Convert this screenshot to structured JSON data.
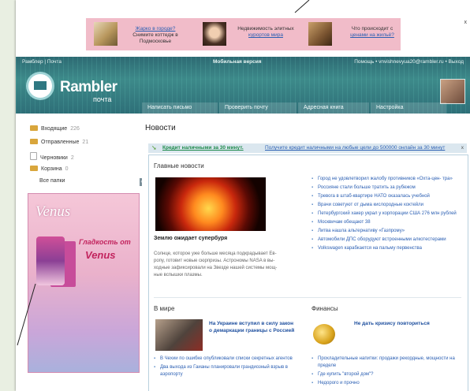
{
  "ads": [
    {
      "link": "Жарко в городе?",
      "text": "Снимите коттедж в Подмосковье"
    },
    {
      "text": "Недвижимость элитных",
      "link": "курортов мира"
    },
    {
      "text": "Что происходит с",
      "link": "ценами на жильё?"
    }
  ],
  "ad_close": "x",
  "header": {
    "left": "Рамблер | Почта",
    "center": "Мобильная версия",
    "right": "Помощь  •  vnvishnevyua20@rambler.ru  •  Выход",
    "logo": "Rambler",
    "logo_sub": "почта",
    "accent": "#2d6a73"
  },
  "tabs": [
    "Написать письмо",
    "Проверить почту",
    "Адресная книга",
    "Настройка"
  ],
  "folders": [
    {
      "label": "Входящие",
      "count": "226",
      "icon": "folder-icon"
    },
    {
      "label": "Отправленные",
      "count": "21",
      "icon": "folder-icon"
    },
    {
      "label": "Черновики",
      "count": "2",
      "icon": "draft-icon"
    },
    {
      "label": "Корзина",
      "count": "0",
      "icon": "trash-icon"
    }
  ],
  "all_folders": "Все папки",
  "venus": {
    "brand": "Venus",
    "slogan1": "Гладкость от",
    "slogan2": "Venus"
  },
  "main": {
    "title": "Новости",
    "credit": {
      "headline": "Кредит наличными за 30 минут.",
      "link": "Получите кредит наличными на любые цели до 500000 онлайн за 30 минут",
      "close": "x"
    },
    "main_news": "Главные новости",
    "lead": {
      "headline": "Землю ожидает супербуря",
      "text": "Солнце, которое уже больше месяца подкрадывает Ев- ропу, готовит новые сюрпризы. Астрономы NASA в вы- ходные зафиксировали на Звезде нашей системы мощ- ные вспышки плазмы."
    },
    "headlines": [
      "Город не удовлетворил жалобу противников «Охта-цен- тра»",
      "Россияне стали больше тратить за рубежом",
      "Тревога в штаб-квартире НАТО оказалась учебной",
      "Врачи советуют от дыма кислородные коктейли",
      "Петербургский хакер украл у корпорации США 276 млн рублей",
      "Москвичам обещают 38",
      "Литва нашла альтернативу «Газпрому»",
      "Автомобили ДПС оборудуют встроенными алкотестерами",
      "Volkswagen карабкается на пальму первенства"
    ],
    "world": {
      "title": "В мире",
      "headline": "На Украине вступил в силу закон о демаркации границы с Россией",
      "items": [
        "В Чехии по ошибке опубликовали списки секретных агентов",
        "Два выхода из Гаианы планировали грандиозный взрыв в аэропорту"
      ]
    },
    "finance": {
      "title": "Финансы",
      "headline": "Не дать кризису повториться",
      "items": [
        "Прохладительные напитки: продажи рекордные, мощности на пределе",
        "Где купить \"второй дом\"?",
        "Недорого и прочно"
      ]
    }
  }
}
